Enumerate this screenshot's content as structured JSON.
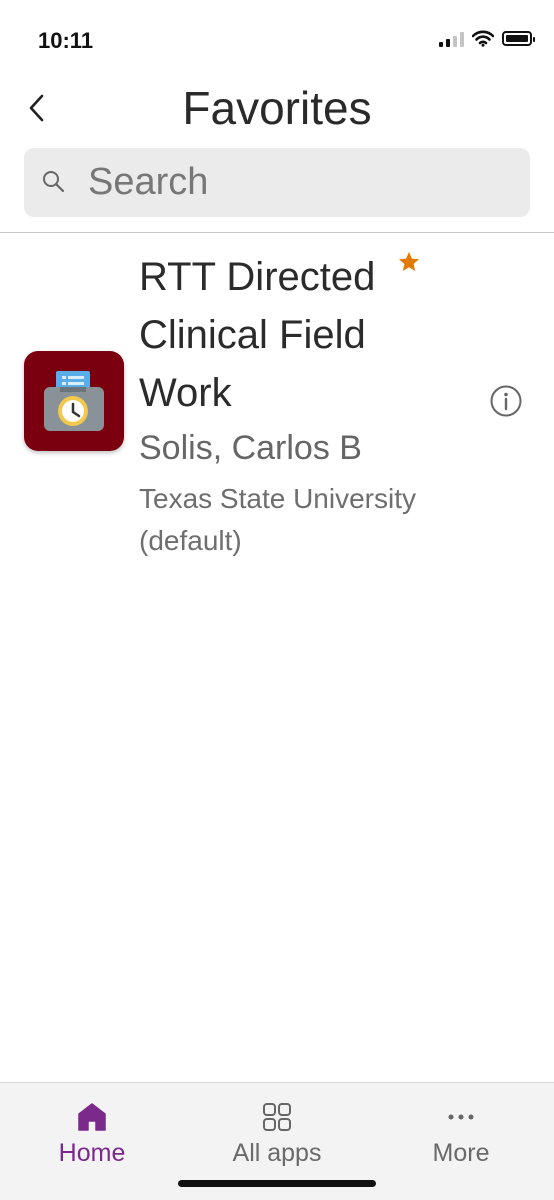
{
  "status_bar": {
    "time": "10:11"
  },
  "header": {
    "title": "Favorites",
    "back_icon": "chevron-left-icon"
  },
  "search": {
    "placeholder": "Search",
    "value": ""
  },
  "favorites": [
    {
      "name": "RTT Directed Clinical Field Work",
      "owner": "Solis, Carlos B",
      "environment": "Texas State University (default)",
      "is_favorite": true,
      "icon": "timecard-clock-icon",
      "icon_bg_color": "#7a0010",
      "star_color": "#e07b00"
    }
  ],
  "tab_bar": {
    "active": "Home",
    "accent_color": "#7b2a8c",
    "tabs": [
      {
        "label": "Home",
        "icon": "home-icon"
      },
      {
        "label": "All apps",
        "icon": "grid-icon"
      },
      {
        "label": "More",
        "icon": "more-icon"
      }
    ]
  }
}
